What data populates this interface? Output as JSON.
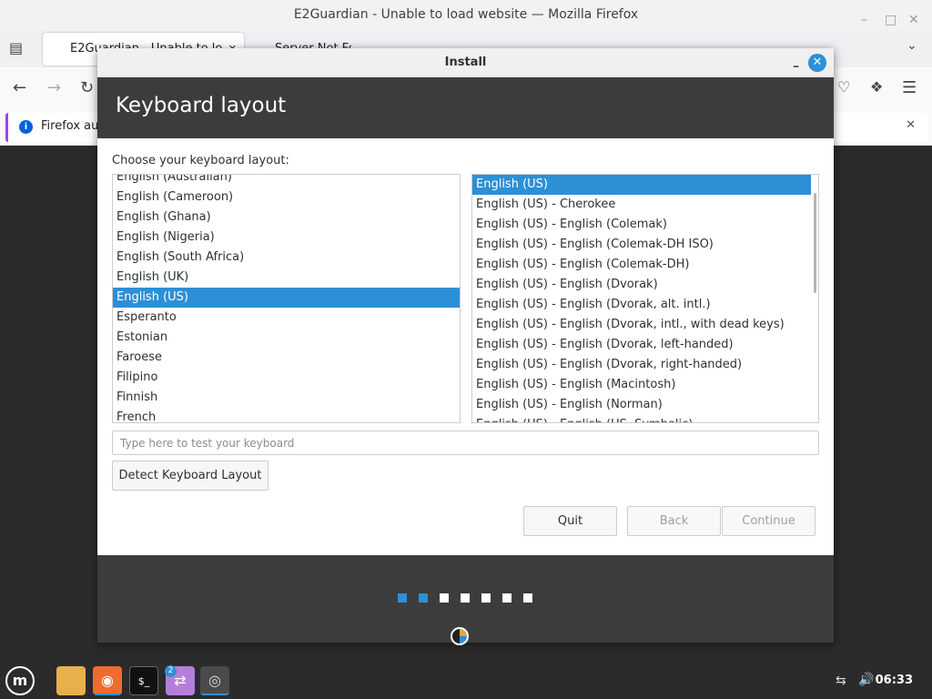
{
  "browser": {
    "window_title": "E2Guardian - Unable to load website — Mozilla Firefox",
    "tabs": [
      {
        "label": "E2Guardian - Unable to lo"
      },
      {
        "label": "Server Not Found"
      }
    ],
    "notification_text": "Firefox au"
  },
  "dialog": {
    "title": "Install",
    "header": "Keyboard layout",
    "prompt": "Choose your keyboard layout:",
    "layouts": [
      {
        "label": "English (Australian)"
      },
      {
        "label": "English (Cameroon)"
      },
      {
        "label": "English (Ghana)"
      },
      {
        "label": "English (Nigeria)"
      },
      {
        "label": "English (South Africa)"
      },
      {
        "label": "English (UK)"
      },
      {
        "label": "English (US)",
        "selected": true
      },
      {
        "label": "Esperanto"
      },
      {
        "label": "Estonian"
      },
      {
        "label": "Faroese"
      },
      {
        "label": "Filipino"
      },
      {
        "label": "Finnish"
      },
      {
        "label": "French"
      }
    ],
    "variants": [
      {
        "label": "English (US)",
        "selected": true
      },
      {
        "label": "English (US) - Cherokee"
      },
      {
        "label": "English (US) - English (Colemak)"
      },
      {
        "label": "English (US) - English (Colemak-DH ISO)"
      },
      {
        "label": "English (US) - English (Colemak-DH)"
      },
      {
        "label": "English (US) - English (Dvorak)"
      },
      {
        "label": "English (US) - English (Dvorak, alt. intl.)"
      },
      {
        "label": "English (US) - English (Dvorak, intl., with dead keys)"
      },
      {
        "label": "English (US) - English (Dvorak, left-handed)"
      },
      {
        "label": "English (US) - English (Dvorak, right-handed)"
      },
      {
        "label": "English (US) - English (Macintosh)"
      },
      {
        "label": "English (US) - English (Norman)"
      },
      {
        "label": "English (US) - English (US, Symbolic)"
      }
    ],
    "test_placeholder": "Type here to test your keyboard",
    "detect_label": "Detect Keyboard Layout",
    "quit_label": "Quit",
    "back_label": "Back",
    "continue_label": "Continue",
    "progress": {
      "current_step": 2,
      "total_steps": 7
    }
  },
  "taskbar": {
    "clock": "06:33",
    "badge_count": "2"
  },
  "colors": {
    "accent": "#2d8fd6",
    "header_bg": "#3c3c3c"
  }
}
